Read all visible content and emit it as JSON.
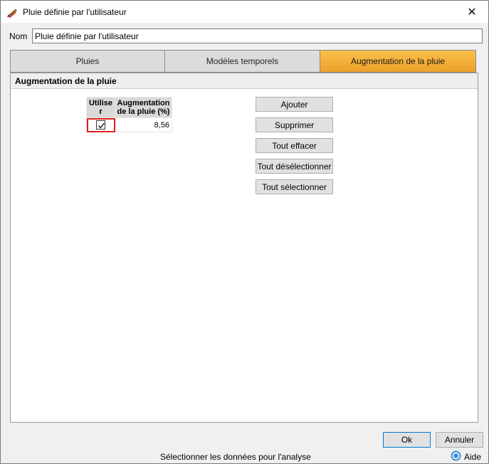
{
  "window": {
    "title": "Pluie définie par l'utilisateur",
    "close_glyph": "✕"
  },
  "nom": {
    "label": "Nom",
    "value": "Pluie définie par l'utilisateur"
  },
  "tabs": [
    {
      "label": "Pluies",
      "active": false
    },
    {
      "label": "Modèles temporels",
      "active": false
    },
    {
      "label": "Augmentation de la pluie",
      "active": true
    }
  ],
  "panel": {
    "header": "Augmentation de la pluie",
    "grid": {
      "columns": [
        "Utilise\nr",
        "Augmentation\nde la pluie (%)"
      ],
      "rows": [
        {
          "use": true,
          "value": "8,56"
        }
      ]
    },
    "buttons": {
      "add": "Ajouter",
      "delete": "Supprimer",
      "clear_all": "Tout effacer",
      "deselect_all": "Tout désélectionner",
      "select_all": "Tout sélectionner"
    }
  },
  "footer": {
    "ok": "Ok",
    "cancel": "Annuler",
    "status": "Sélectionner les données pour l'analyse",
    "help": "Aide"
  },
  "colors": {
    "active_tab": "#f0a830",
    "selection_outline": "#e02020"
  },
  "icons": {
    "app": "pencil-rain-icon",
    "help": "help-icon",
    "check": "checkmark-icon"
  }
}
